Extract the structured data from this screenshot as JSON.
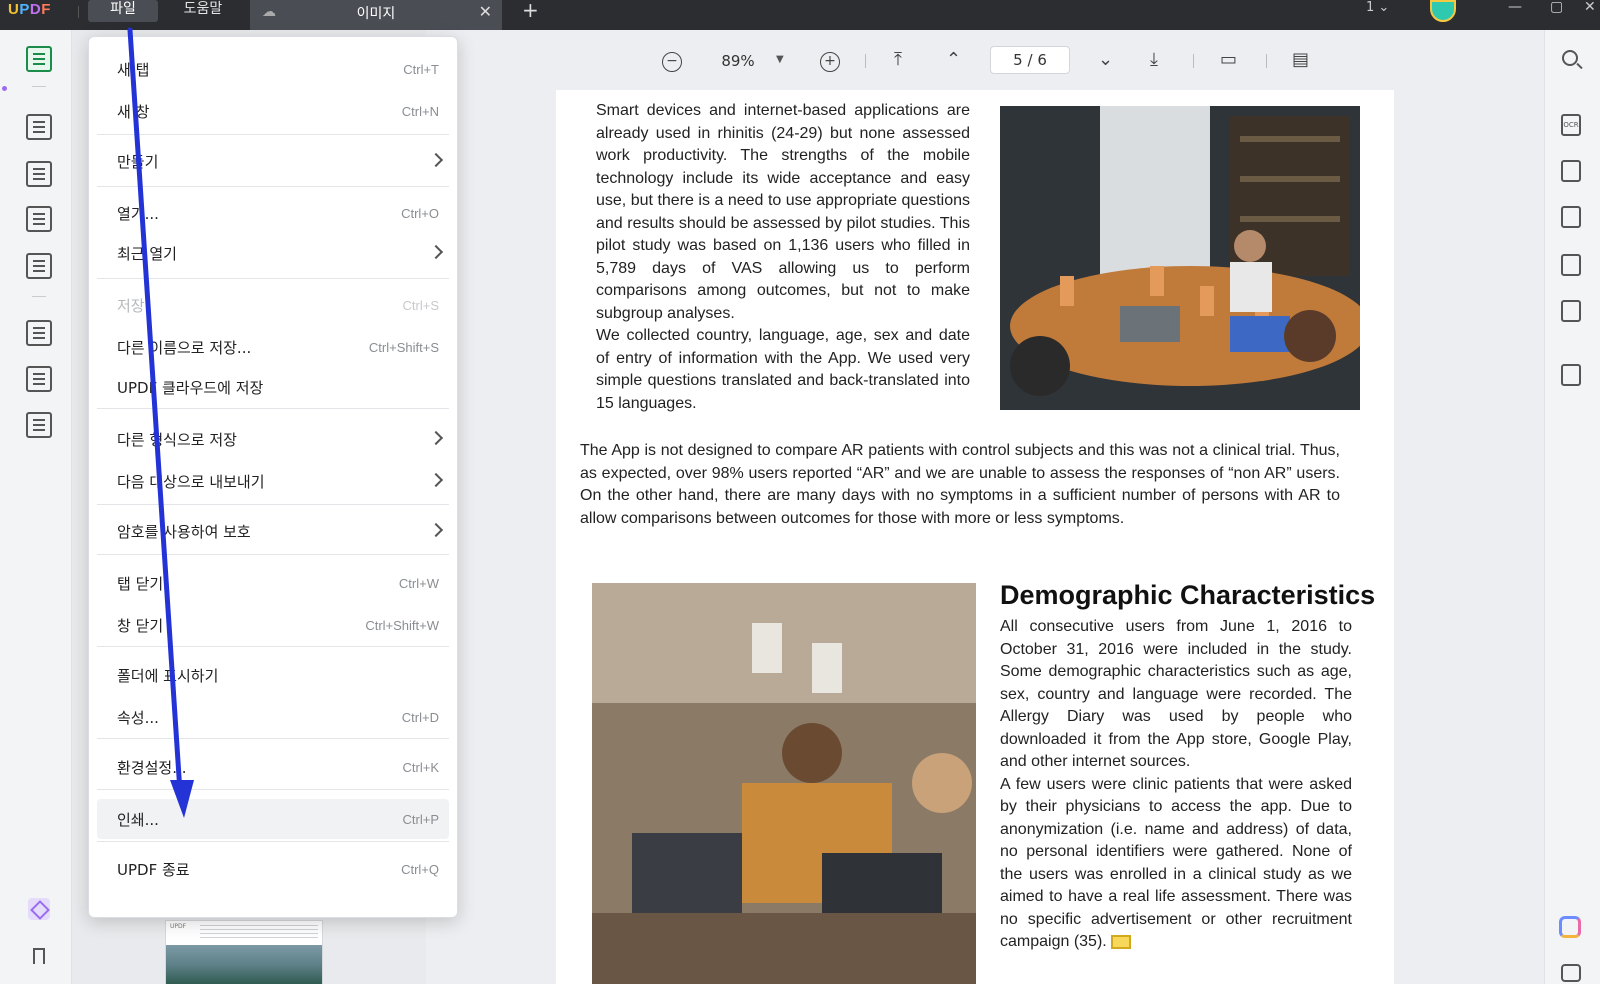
{
  "app": {
    "logo": "UPDF"
  },
  "menubar": {
    "file": "파일",
    "help": "도움말"
  },
  "tab": {
    "label": "이미지",
    "close": "✕",
    "add": "+"
  },
  "window": {
    "count": "1",
    "minimize": "—",
    "maximize": "▢",
    "close": "✕"
  },
  "toolbar": {
    "zoom": "89%",
    "page_current": "5",
    "page_total": "6",
    "page_sep": "/"
  },
  "file_menu": [
    {
      "label": "새 탭",
      "shortcut": "Ctrl+T"
    },
    {
      "label": "새 창",
      "shortcut": "Ctrl+N"
    },
    {
      "label": "만들기",
      "submenu": true
    },
    {
      "label": "열기...",
      "shortcut": "Ctrl+O"
    },
    {
      "label": "최근 열기",
      "submenu": true
    },
    {
      "label": "저장",
      "shortcut": "Ctrl+S",
      "disabled": true
    },
    {
      "label": "다른 이름으로 저장...",
      "shortcut": "Ctrl+Shift+S"
    },
    {
      "label": "UPDF 클라우드에 저장"
    },
    {
      "label": "다른 형식으로 저장",
      "submenu": true
    },
    {
      "label": "다음 대상으로 내보내기",
      "submenu": true
    },
    {
      "label": "암호를 사용하여 보호",
      "submenu": true
    },
    {
      "label": "탭 닫기",
      "shortcut": "Ctrl+W"
    },
    {
      "label": "창 닫기",
      "shortcut": "Ctrl+Shift+W"
    },
    {
      "label": "폴더에 표시하기"
    },
    {
      "label": "속성...",
      "shortcut": "Ctrl+D"
    },
    {
      "label": "환경설정...",
      "shortcut": "Ctrl+K"
    },
    {
      "label": "인쇄...",
      "shortcut": "Ctrl+P",
      "hover": true
    },
    {
      "label": "UPDF 종료",
      "shortcut": "Ctrl+Q"
    }
  ],
  "document": {
    "col1_p1": "Smart devices and internet-based applications are already used in rhinitis (24-29) but none assessed work productivity. The strengths of the mobile technology include its wide acceptance and easy use, but there is a need to use appropriate questions and results should be assessed by pilot studies. This pilot study was based on 1,136 users who filled in 5,789 days of VAS allowing us to perform comparisons among outcomes, but not to make subgroup analyses.",
    "col1_p2": "We collected country, language, age, sex and date of entry of information with the App. We used very simple questions translated and back-translated into 15 languages.",
    "full_p": "The App is not designed to compare AR patients with control subjects and this was not a clinical trial. Thus, as expected, over 98% users reported “AR” and we are unable to assess the responses of “non AR” users. On the other hand, there are many days with no symptoms in a sufficient number of persons with AR to allow comparisons between outcomes for those with more or less symptoms.",
    "heading": "Demographic Characteristics",
    "col2_p1": "All consecutive users from June 1, 2016 to October 31, 2016 were included in the study. Some demographic characteristics such as age, sex, country and language were recorded. The Allergy Diary was used by people who downloaded it from the App store, Google Play, and other internet sources.",
    "col2_p2": "A few users were clinic patients that were asked by their physicians to access the app. Due to anonymization (i.e. name and address) of data, no personal identifiers were gathered. None of the users was enrolled in a clinical study as we aimed to have a real life assessment. There was no specific advertisement or other recruitment campaign (35)."
  },
  "thumbnail": {
    "logo": "UPDF"
  },
  "colors": {
    "accent_green": "#1a8d4a",
    "annotation_arrow": "#2433d6",
    "titlebar": "#2b2d31"
  }
}
